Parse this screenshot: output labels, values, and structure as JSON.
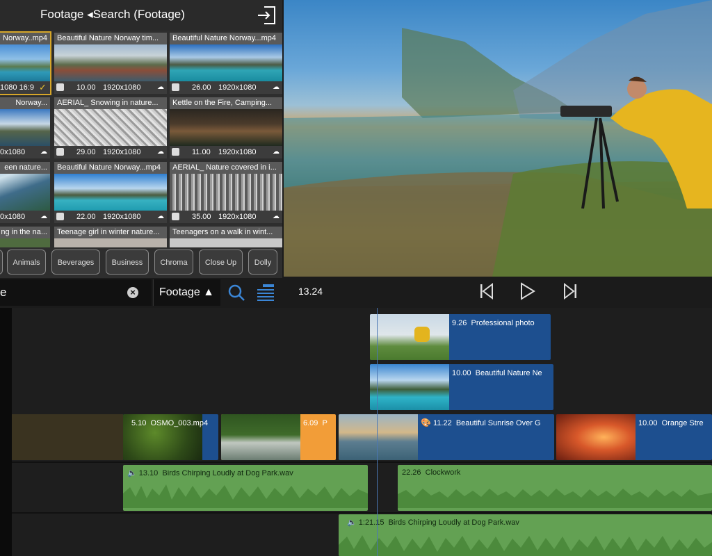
{
  "library": {
    "title": "Footage ◂Search (Footage)",
    "tiles": [
      {
        "name": "Norway..mp4",
        "duration": "",
        "resolution": "1080 16:9",
        "selected": true
      },
      {
        "name": "Beautiful Nature Norway tim...",
        "duration": "10.00",
        "resolution": "1920x1080"
      },
      {
        "name": "Beautiful Nature Norway...mp4",
        "duration": "26.00",
        "resolution": "1920x1080"
      },
      {
        "name": "Norway...",
        "duration": "",
        "resolution": "0x1080"
      },
      {
        "name": "AERIAL_ Snowing in nature...",
        "duration": "29.00",
        "resolution": "1920x1080"
      },
      {
        "name": "Kettle on the Fire, Camping...",
        "duration": "11.00",
        "resolution": "1920x1080"
      },
      {
        "name": "een nature...",
        "duration": "",
        "resolution": "0x1080"
      },
      {
        "name": "Beautiful Nature Norway...mp4",
        "duration": "22.00",
        "resolution": "1920x1080"
      },
      {
        "name": "AERIAL_ Nature covered in i...",
        "duration": "35.00",
        "resolution": "1920x1080"
      },
      {
        "name": "ng in the na...",
        "duration": "",
        "resolution": ""
      },
      {
        "name": "Teenage girl in winter nature...",
        "duration": "",
        "resolution": ""
      },
      {
        "name": "Teenagers on a walk in wint...",
        "duration": "",
        "resolution": ""
      }
    ],
    "categories": [
      "Animals",
      "Beverages",
      "Business",
      "Chroma",
      "Close Up",
      "Dolly"
    ]
  },
  "search": {
    "value": "e",
    "source": "Footage ▲"
  },
  "transport": {
    "timecode": "13.24"
  },
  "timeline": {
    "overlay_clips": [
      {
        "duration": "9.26",
        "title": "Professional photo"
      },
      {
        "duration": "10.00",
        "title": "Beautiful Nature Ne"
      }
    ],
    "main_clips": [
      {
        "duration": "5.10",
        "title": "OSMO_003.mp4"
      },
      {
        "duration": "6.09",
        "title": "P"
      },
      {
        "duration": "11.22",
        "title": "Beautiful Sunrise Over G"
      },
      {
        "duration": "10.00",
        "title": "Orange Stre"
      }
    ],
    "audio_clips": [
      {
        "duration": "13.10",
        "title": "Birds Chirping Loudly at Dog Park.wav"
      },
      {
        "duration": "22.26",
        "title": "Clockwork"
      },
      {
        "duration": "1:21.15",
        "title": "Birds Chirping Loudly at Dog Park.wav"
      }
    ]
  },
  "colors": {
    "clip_blue": "#1d4f8f",
    "audio_green": "#63a153",
    "highlight_orange": "#f29d38",
    "accent_blue": "#3b86d6"
  }
}
